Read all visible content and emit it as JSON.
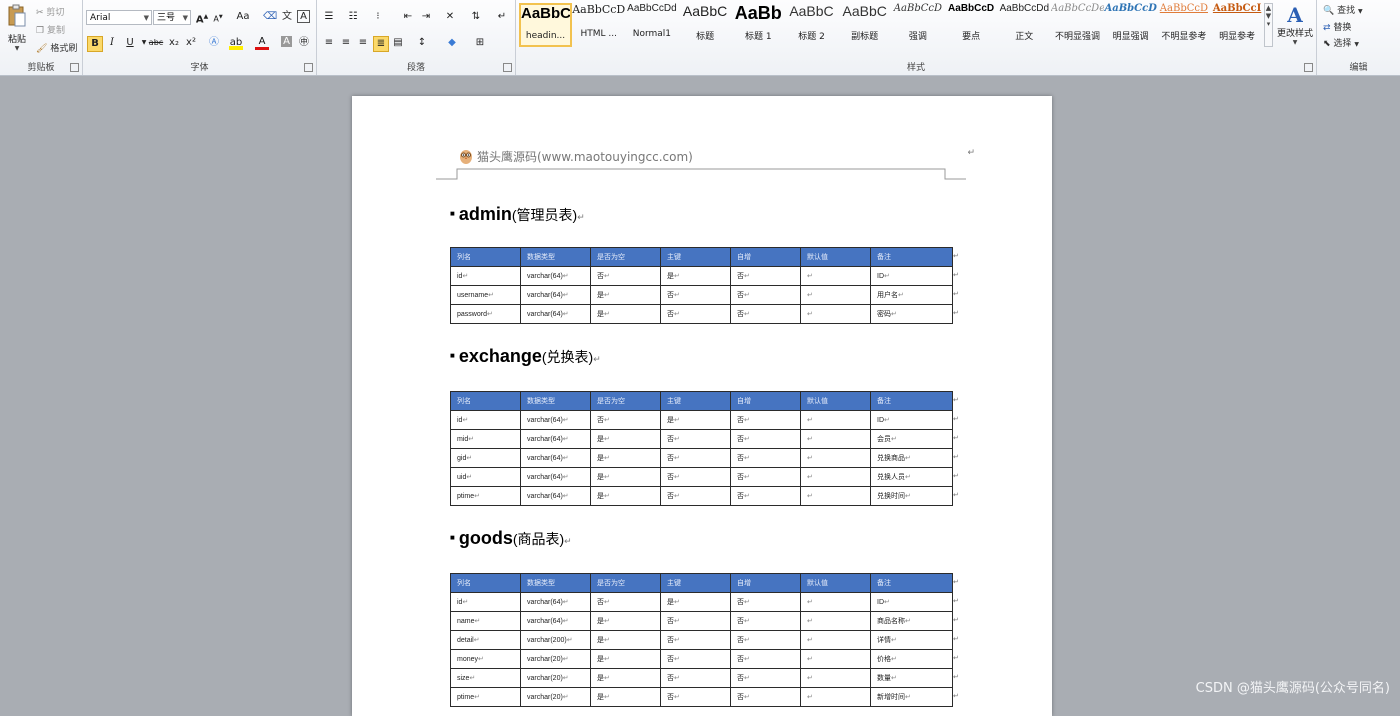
{
  "ribbon": {
    "clipboard": {
      "group_label": "剪贴板",
      "paste_label": "粘贴",
      "cut_label": "剪切",
      "copy_label": "复制",
      "format_painter_label": "格式刷"
    },
    "font": {
      "group_label": "字体",
      "font_name": "Arial",
      "font_size": "三号",
      "grow_label": "A",
      "shrink_label": "A",
      "case_label": "Aa",
      "bold": "B",
      "italic": "I",
      "underline": "U",
      "strike": "abc",
      "subscript": "x₂",
      "superscript": "x²"
    },
    "paragraph": {
      "group_label": "段落"
    },
    "styles": {
      "group_label": "样式",
      "change_styles_label": "更改样式",
      "items": [
        {
          "preview": "AaBbC",
          "name": "headin..."
        },
        {
          "preview": "AaBbCcDc",
          "name": "HTML ..."
        },
        {
          "preview": "AaBbCcDd",
          "name": "Normal1"
        },
        {
          "preview": "AaBbC",
          "name": "标题"
        },
        {
          "preview": "AaBb",
          "name": "标题 1"
        },
        {
          "preview": "AaBbC",
          "name": "标题 2"
        },
        {
          "preview": "AaBbC",
          "name": "副标题"
        },
        {
          "preview": "AaBbCcD",
          "name": "强调"
        },
        {
          "preview": "AaBbCcD",
          "name": "要点"
        },
        {
          "preview": "AaBbCcDd",
          "name": "正文"
        },
        {
          "preview": "AaBbCcDe",
          "name": "不明显强调"
        },
        {
          "preview": "AaBbCcD",
          "name": "明显强调"
        },
        {
          "preview": "AaBbCcD",
          "name": "不明显参考"
        },
        {
          "preview": "AaBbCcI",
          "name": "明显参考"
        }
      ]
    },
    "editing": {
      "group_label": "编辑",
      "find_label": "查找",
      "replace_label": "替换",
      "select_label": "选择"
    }
  },
  "document": {
    "header_text": "猫头鹰源码(www.maotouyingcc.com)",
    "column_headers": [
      "列名",
      "数据类型",
      "是否为空",
      "主键",
      "自增",
      "默认值",
      "备注"
    ],
    "tables": [
      {
        "name_en": "admin",
        "name_cn": "(管理员表)",
        "rows": [
          [
            "id",
            "varchar(64)",
            "否",
            "是",
            "否",
            "",
            "ID"
          ],
          [
            "username",
            "varchar(64)",
            "是",
            "否",
            "否",
            "",
            "用户名"
          ],
          [
            "password",
            "varchar(64)",
            "是",
            "否",
            "否",
            "",
            "密码"
          ]
        ]
      },
      {
        "name_en": "exchange",
        "name_cn": "(兑换表)",
        "rows": [
          [
            "id",
            "varchar(64)",
            "否",
            "是",
            "否",
            "",
            "ID"
          ],
          [
            "mid",
            "varchar(64)",
            "是",
            "否",
            "否",
            "",
            "会员"
          ],
          [
            "gid",
            "varchar(64)",
            "是",
            "否",
            "否",
            "",
            "兑换商品"
          ],
          [
            "uid",
            "varchar(64)",
            "是",
            "否",
            "否",
            "",
            "兑换人员"
          ],
          [
            "ptime",
            "varchar(64)",
            "是",
            "否",
            "否",
            "",
            "兑换时间"
          ]
        ]
      },
      {
        "name_en": "goods",
        "name_cn": "(商品表)",
        "rows": [
          [
            "id",
            "varchar(64)",
            "否",
            "是",
            "否",
            "",
            "ID"
          ],
          [
            "name",
            "varchar(64)",
            "是",
            "否",
            "否",
            "",
            "商品名称"
          ],
          [
            "detail",
            "varchar(200)",
            "是",
            "否",
            "否",
            "",
            "详情"
          ],
          [
            "money",
            "varchar(20)",
            "是",
            "否",
            "否",
            "",
            "价格"
          ],
          [
            "size",
            "varchar(20)",
            "是",
            "否",
            "否",
            "",
            "数量"
          ],
          [
            "ptime",
            "varchar(20)",
            "是",
            "否",
            "否",
            "",
            "新增时间"
          ]
        ]
      }
    ]
  },
  "watermark": "CSDN @猫头鹰源码(公众号同名)",
  "colors": {
    "table_header_bg": "#4674c1",
    "style_selected": "#f2c24f"
  }
}
